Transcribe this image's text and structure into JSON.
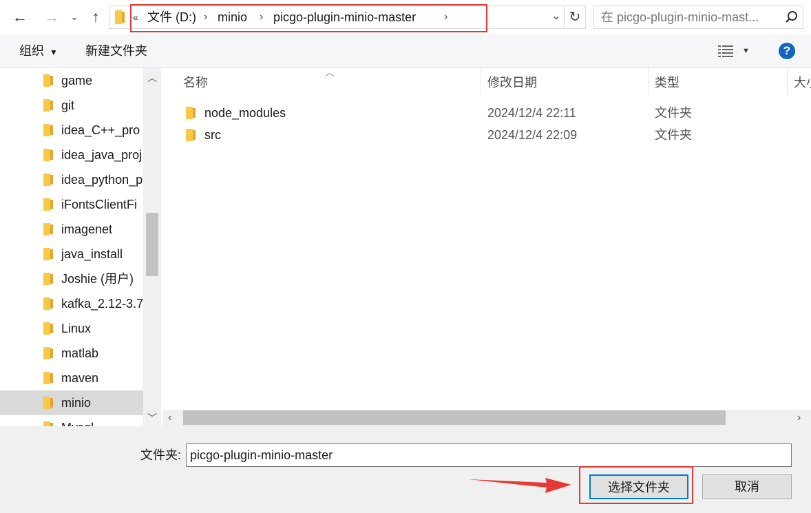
{
  "address_bar": {
    "overflow": "«",
    "crumbs": [
      "文件 (D:)",
      "minio",
      "picgo-plugin-minio-master"
    ],
    "search_placeholder": "在 picgo-plugin-minio-mast..."
  },
  "toolbar": {
    "organize": "组织",
    "new_folder": "新建文件夹"
  },
  "nav": {
    "items": [
      "game",
      "git",
      "idea_C++_pro",
      "idea_java_proj",
      "idea_python_p",
      "iFontsClientFi",
      "imagenet",
      "java_install",
      "Joshie (用户)",
      "kafka_2.12-3.7",
      "Linux",
      "matlab",
      "maven",
      "minio",
      "Mysql"
    ],
    "selected": "minio"
  },
  "list": {
    "columns": {
      "name": "名称",
      "date": "修改日期",
      "type": "类型",
      "size": "大小"
    },
    "rows": [
      {
        "name": "node_modules",
        "date": "2024/12/4 22:11",
        "type": "文件夹"
      },
      {
        "name": "src",
        "date": "2024/12/4 22:09",
        "type": "文件夹"
      }
    ]
  },
  "footer": {
    "folder_label": "文件夹:",
    "folder_value": "picgo-plugin-minio-master",
    "select_button": "选择文件夹",
    "cancel_button": "取消"
  },
  "colors": {
    "folder": "#f8c846",
    "annotation_red": "#e53935",
    "help_blue": "#1565c0",
    "selected_nav": "#d9d9d9"
  }
}
